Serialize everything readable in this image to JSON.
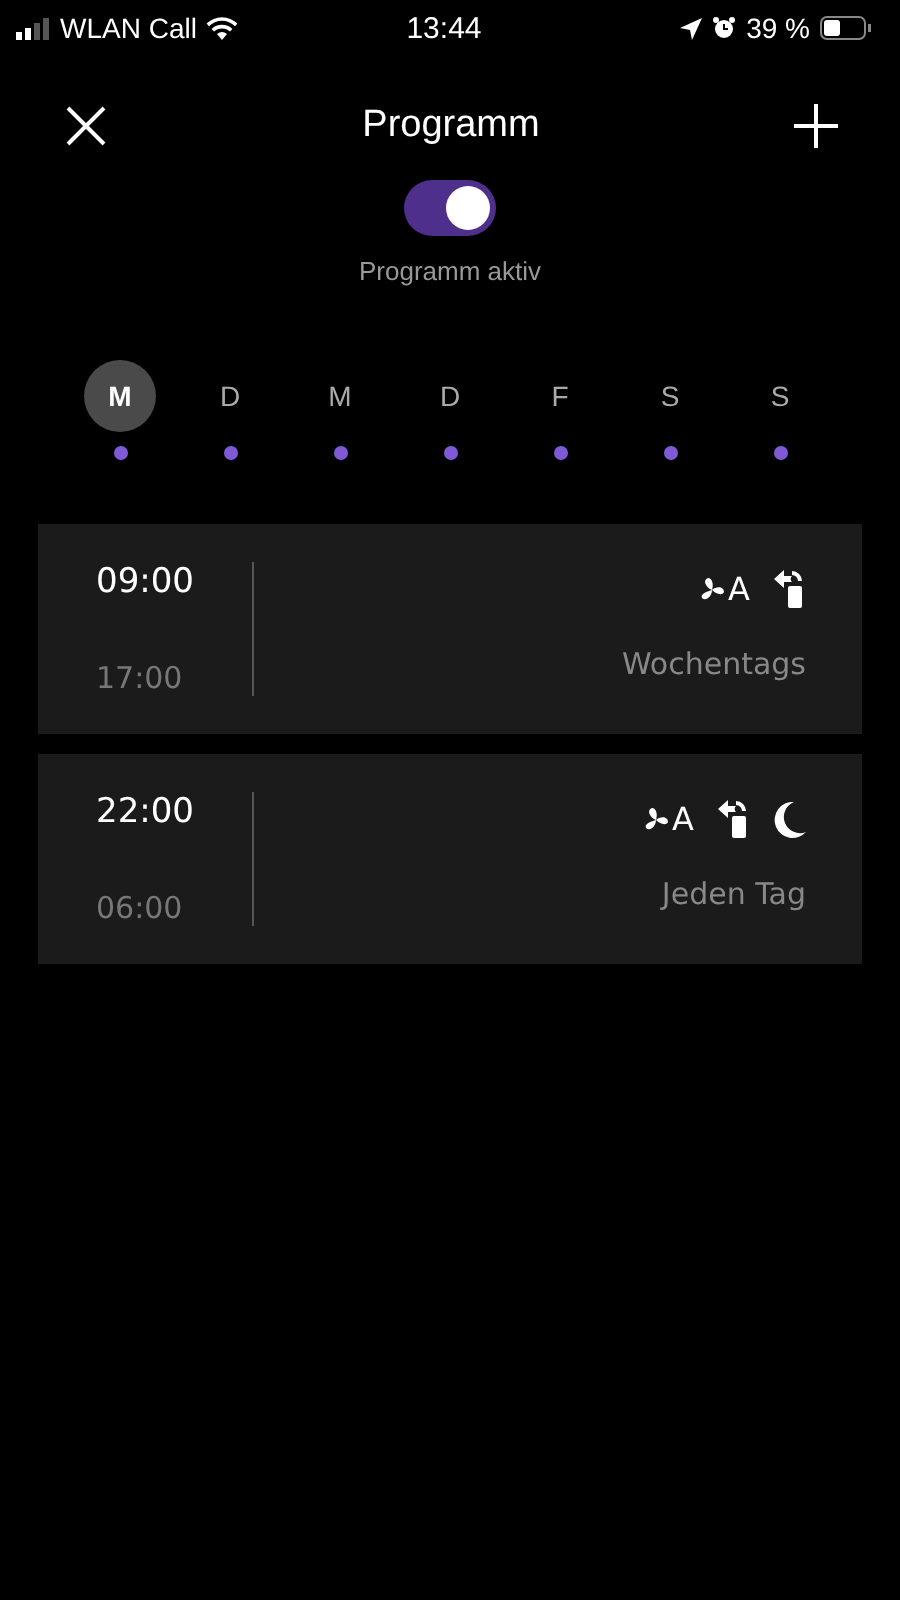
{
  "status_bar": {
    "carrier": "WLAN Call",
    "time": "13:44",
    "battery": "39 %"
  },
  "header": {
    "title": "Programm"
  },
  "toggle": {
    "on": true,
    "label": "Programm aktiv"
  },
  "days": [
    {
      "label": "M",
      "selected": true
    },
    {
      "label": "D",
      "selected": false
    },
    {
      "label": "M",
      "selected": false
    },
    {
      "label": "D",
      "selected": false
    },
    {
      "label": "F",
      "selected": false
    },
    {
      "label": "S",
      "selected": false
    },
    {
      "label": "S",
      "selected": false
    }
  ],
  "programs": [
    {
      "start": "09:00",
      "end": "17:00",
      "repeat": "Wochentags",
      "icons": [
        {
          "kind": "fan",
          "label": "A"
        },
        {
          "kind": "oscillation"
        }
      ]
    },
    {
      "start": "22:00",
      "end": "06:00",
      "repeat": "Jeden Tag",
      "icons": [
        {
          "kind": "fan",
          "label": "A"
        },
        {
          "kind": "oscillation"
        },
        {
          "kind": "night"
        }
      ]
    }
  ]
}
